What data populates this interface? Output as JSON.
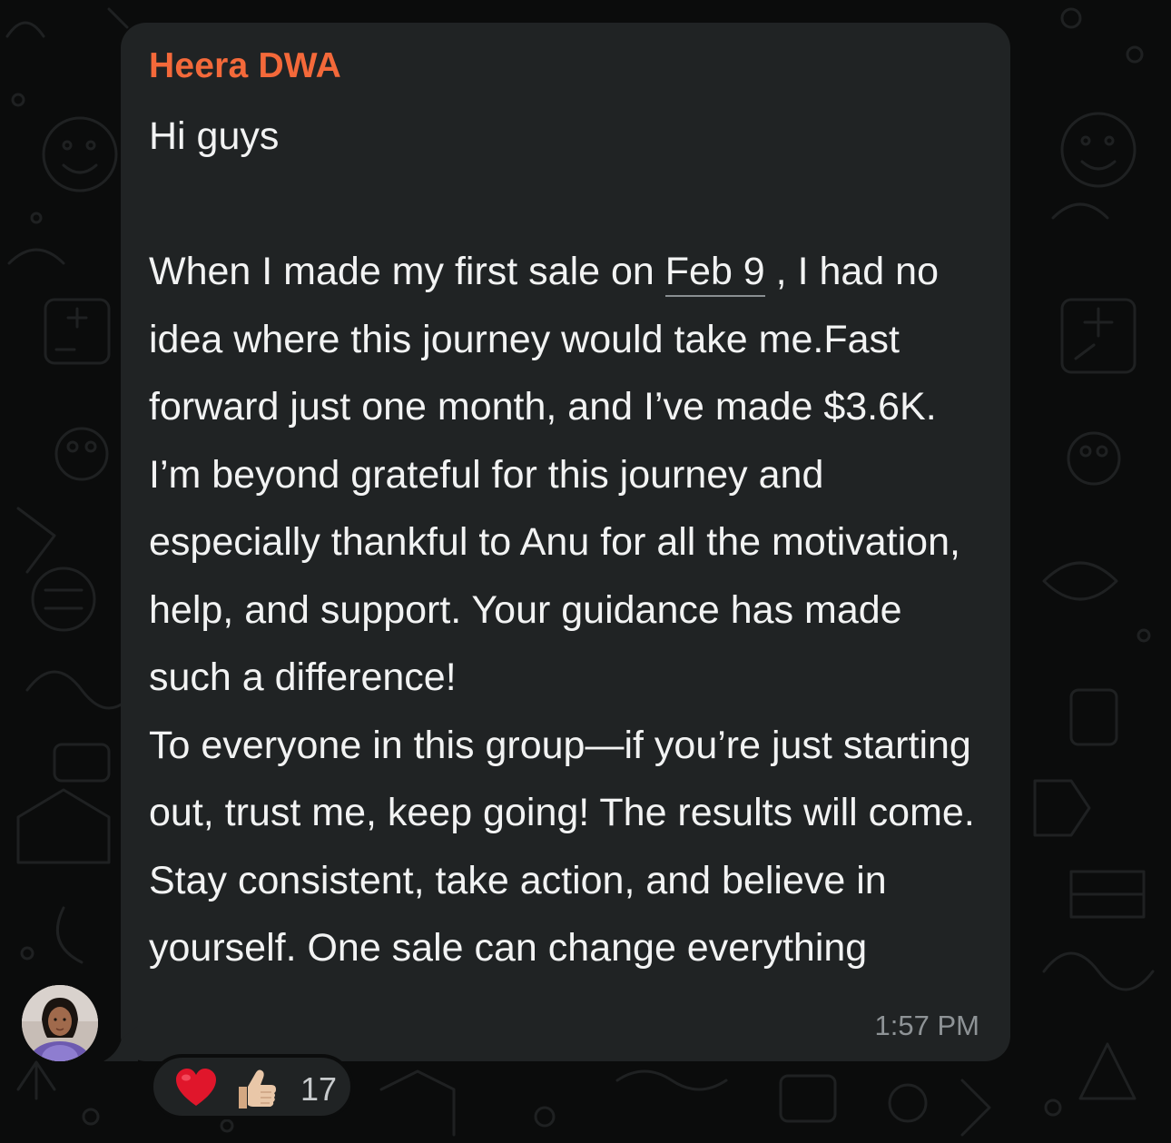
{
  "message": {
    "sender": "Heera DWA",
    "text_before_link": "Hi guys\n\nWhen I made my first sale on ",
    "date_link": "Feb 9",
    "text_after_link": " , I had no idea where this journey would take me.Fast forward just one month, and I’ve made $3.6K. I’m beyond grateful for this journey and especially thankful to Anu for all the motivation, help, and support. Your guidance has made such a difference!\nTo everyone in this group—if you’re just starting out, trust me, keep going! The results will come. Stay consistent, take action, and believe in yourself. One sale can change everything",
    "time": "1:57 PM"
  },
  "reactions": {
    "emojis": [
      "heart-icon",
      "thumbs-up-icon"
    ],
    "count": "17"
  },
  "colors": {
    "background": "#0b0c0c",
    "bubble": "#202324",
    "sender_name": "#f4693a",
    "message_text": "#f2f3f3",
    "timestamp": "#8e9396"
  }
}
